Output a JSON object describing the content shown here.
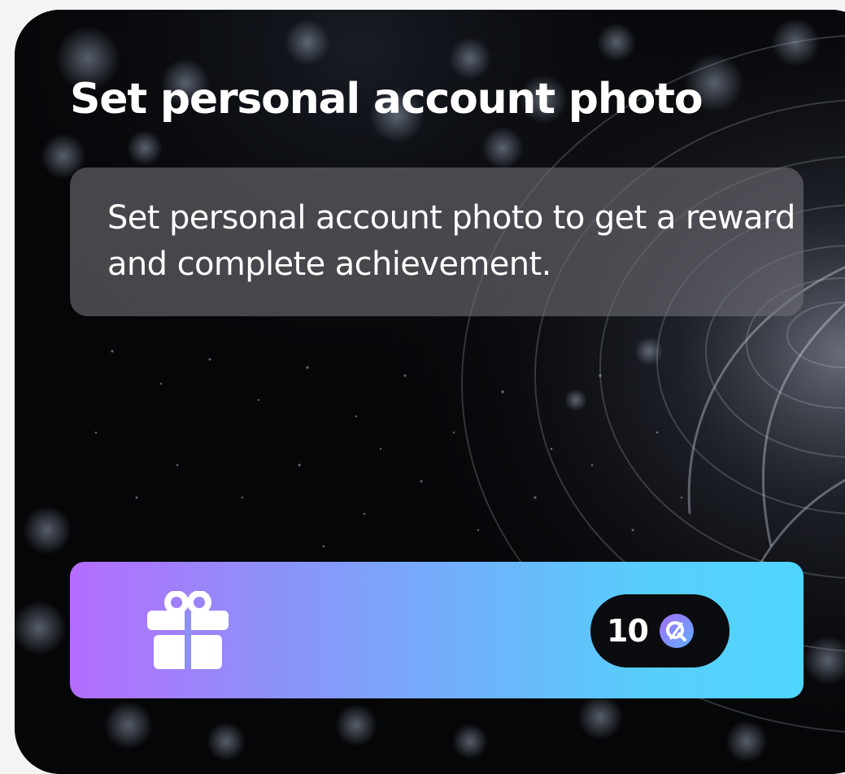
{
  "achievement": {
    "title": "Set personal account photo",
    "description": "Set personal account photo to get a reward and complete achievement."
  },
  "reward": {
    "icon": "gift-icon",
    "amount": "10",
    "currency_icon": "coin-icon"
  },
  "colors": {
    "card_background": "#050608",
    "gradient_start": "#b56cff",
    "gradient_end": "#50d6fd",
    "pill_background": "#0a0c10",
    "text": "#ffffff"
  }
}
